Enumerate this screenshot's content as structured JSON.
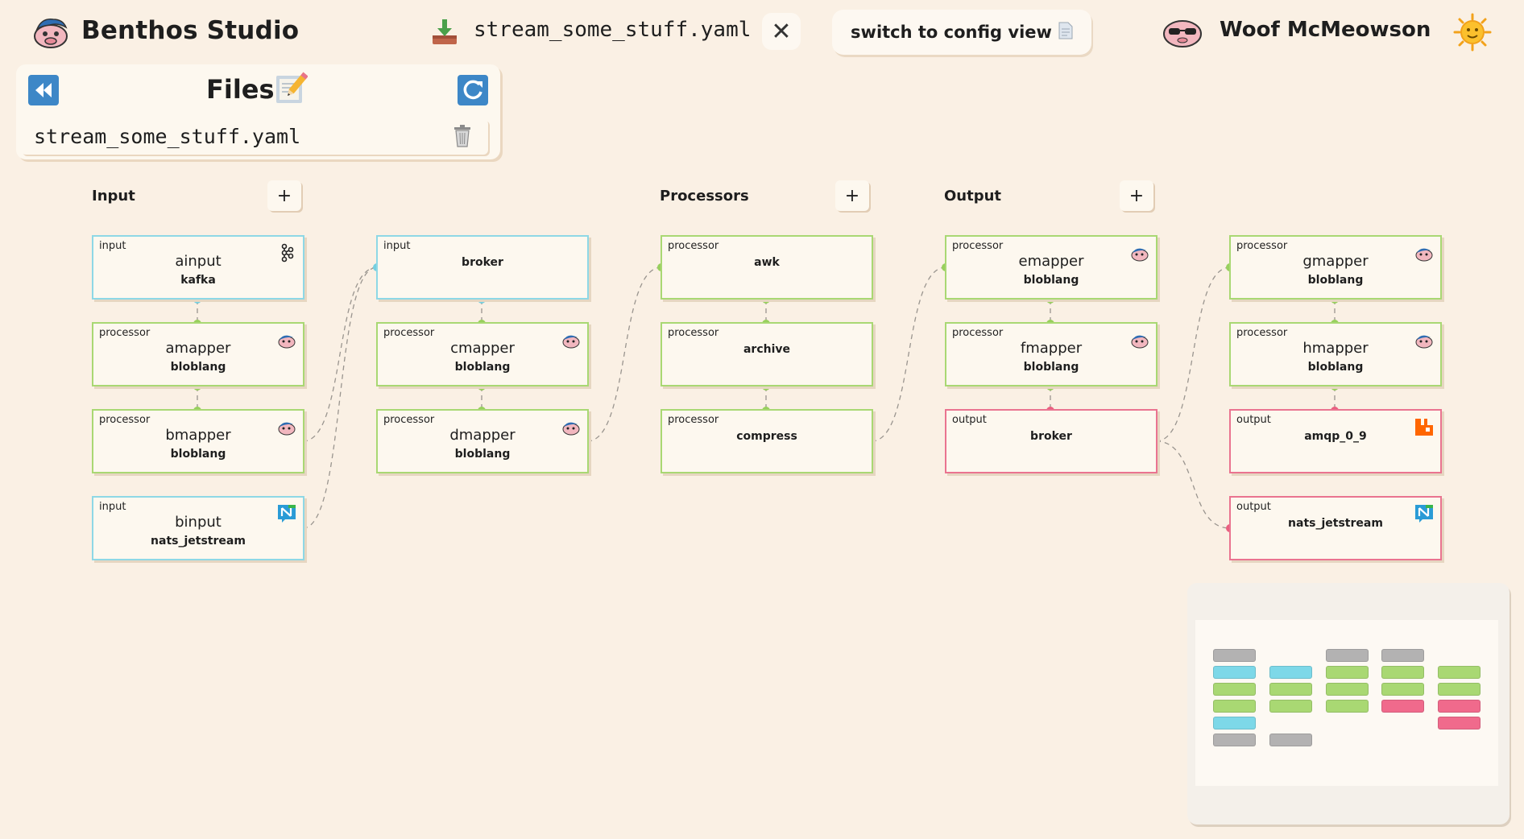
{
  "header": {
    "app_title": "Benthos Studio",
    "brand_icon": "blobfish-logo-icon",
    "file_icon": "download-icon",
    "file_name": "stream_some_stuff.yaml",
    "close_label": "✕",
    "switch_label": "switch to config view",
    "switch_icon": "document-icon",
    "user_avatar": "sunglasses-avatar-icon",
    "user_name": "Woof McMeowson",
    "theme_icon": "sun-icon"
  },
  "files": {
    "title": "Files",
    "back_icon": "rewind-icon",
    "edit_icon": "pencil-memo-icon",
    "refresh_icon": "refresh-icon",
    "items": [
      {
        "name": "stream_some_stuff.yaml",
        "action_icon": "trash-icon"
      }
    ]
  },
  "sections": {
    "input": {
      "title": "Input",
      "add_label": "+"
    },
    "processors": {
      "title": "Processors",
      "add_label": "+"
    },
    "output": {
      "title": "Output",
      "add_label": "+"
    }
  },
  "nodes": {
    "ainput": {
      "kind": "input",
      "label": "ainput",
      "type": "kafka",
      "icon": "kafka-icon"
    },
    "amapper": {
      "kind": "processor",
      "label": "amapper",
      "type": "bloblang",
      "icon": "bloblang-icon"
    },
    "bmapper": {
      "kind": "processor",
      "label": "bmapper",
      "type": "bloblang",
      "icon": "bloblang-icon"
    },
    "binput": {
      "kind": "input",
      "label": "binput",
      "type": "nats_jetstream",
      "icon": "nats-icon"
    },
    "in_broker": {
      "kind": "input",
      "type": "broker"
    },
    "cmapper": {
      "kind": "processor",
      "label": "cmapper",
      "type": "bloblang",
      "icon": "bloblang-icon"
    },
    "dmapper": {
      "kind": "processor",
      "label": "dmapper",
      "type": "bloblang",
      "icon": "bloblang-icon"
    },
    "awk": {
      "kind": "processor",
      "type": "awk"
    },
    "archive": {
      "kind": "processor",
      "type": "archive"
    },
    "compress": {
      "kind": "processor",
      "type": "compress"
    },
    "emapper": {
      "kind": "processor",
      "label": "emapper",
      "type": "bloblang",
      "icon": "bloblang-icon"
    },
    "fmapper": {
      "kind": "processor",
      "label": "fmapper",
      "type": "bloblang",
      "icon": "bloblang-icon"
    },
    "out_broker": {
      "kind": "output",
      "type": "broker"
    },
    "gmapper": {
      "kind": "processor",
      "label": "gmapper",
      "type": "bloblang",
      "icon": "bloblang-icon"
    },
    "hmapper": {
      "kind": "processor",
      "label": "hmapper",
      "type": "bloblang",
      "icon": "bloblang-icon"
    },
    "amqp": {
      "kind": "output",
      "type": "amqp_0_9",
      "icon": "rabbitmq-icon"
    },
    "nats_out": {
      "kind": "output",
      "type": "nats_jetstream",
      "icon": "nats-icon"
    }
  },
  "colors": {
    "background": "#faf0e4",
    "input": "#8ed8e6",
    "processor": "#a9d873",
    "output": "#ea7490",
    "grey": "#b3b2b2"
  }
}
